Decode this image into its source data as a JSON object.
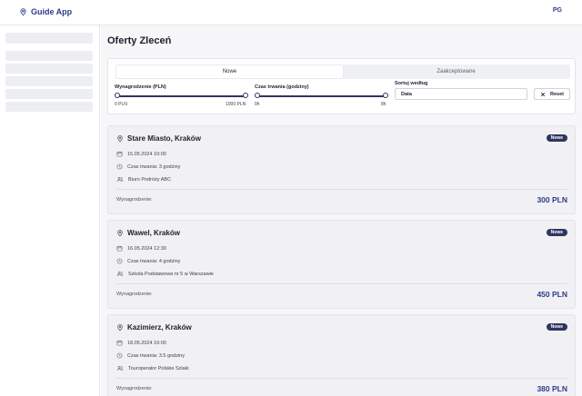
{
  "app": {
    "name": "Guide App",
    "user_initials": "PG"
  },
  "page": {
    "title": "Oferty Zleceń"
  },
  "filters": {
    "tabs": [
      {
        "label": "Nowe",
        "active": true
      },
      {
        "label": "Zaakceptowane",
        "active": false
      }
    ],
    "salary": {
      "label": "Wynagrodzenie (PLN)",
      "min_label": "0 PLN",
      "max_label": "1000 PLN"
    },
    "duration": {
      "label": "Czas trwania (godziny)",
      "min_label": "0h",
      "max_label": "8h"
    },
    "sort": {
      "label": "Sortuj według",
      "value": "Data"
    },
    "reset_label": "Reset"
  },
  "offers": [
    {
      "title": "Stare Miasto, Kraków",
      "badge": "Nowe",
      "date": "15.05.2024 10:00",
      "duration": "Czas trwania: 3 godziny",
      "client": "Biuro Podróży ABC",
      "pay_label": "Wynagrodzenie:",
      "pay": "300 PLN"
    },
    {
      "title": "Wawel, Kraków",
      "badge": "Nowe",
      "date": "16.05.2024 12:30",
      "duration": "Czas trwania: 4 godziny",
      "client": "Szkoła Podstawowa nr 5 w Warszawie",
      "pay_label": "Wynagrodzenie:",
      "pay": "450 PLN"
    },
    {
      "title": "Kazimierz, Kraków",
      "badge": "Nowe",
      "date": "18.05.2024 16:00",
      "duration": "Czas trwania: 3.5 godziny",
      "client": "Touroperator Polskie Szlaki",
      "pay_label": "Wynagrodzenie:",
      "pay": "380 PLN"
    }
  ],
  "icons": {
    "brand": "map-pin-icon",
    "location": "map-pin-icon",
    "date": "calendar-icon",
    "duration": "clock-icon",
    "client": "users-icon",
    "reset": "close-icon"
  },
  "colors": {
    "accent": "#2e3a8c",
    "badge": "#2f3561"
  }
}
